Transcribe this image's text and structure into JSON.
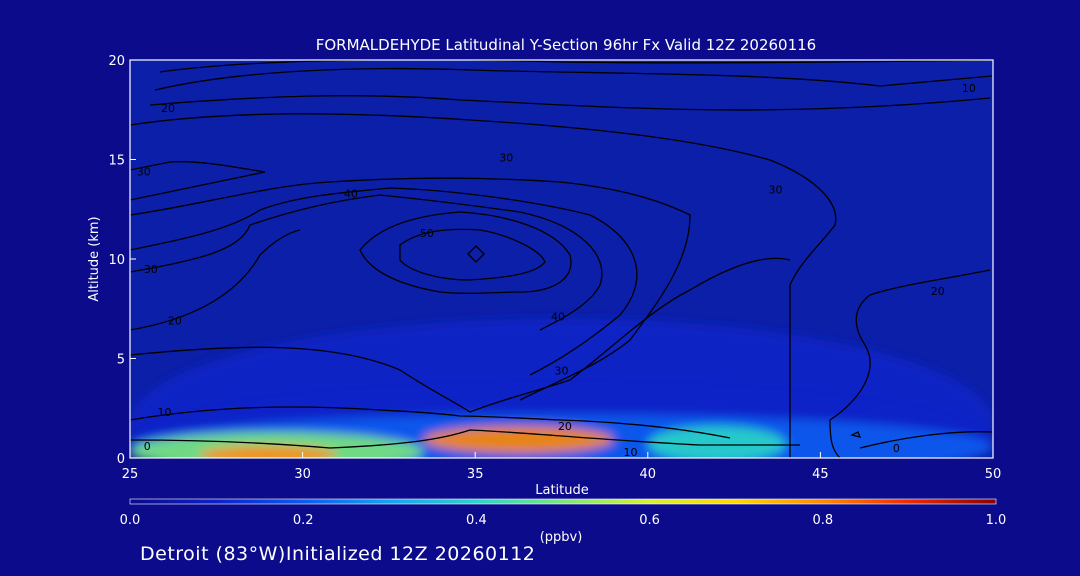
{
  "chart_data": {
    "type": "heatmap",
    "title": "FORMALDEHYDE Latitudinal Y-Section 96hr  Fx Valid 12Z 20260116",
    "xlabel": "Latitude",
    "ylabel": "Altitude (km)",
    "xlim": [
      25,
      50
    ],
    "ylim": [
      0,
      20
    ],
    "x_ticks": [
      "25",
      "30",
      "35",
      "40",
      "45",
      "50"
    ],
    "y_ticks": [
      "0",
      "5",
      "10",
      "15",
      "20"
    ],
    "colorbar": {
      "label": "(ppbv)",
      "range": [
        0.0,
        1.0
      ],
      "ticks": [
        "0.0",
        "0.2",
        "0.4",
        "0.6",
        "0.8",
        "1.0"
      ]
    },
    "colorscale": [
      "#0a0a8c",
      "#0c22c8",
      "#0a5cf0",
      "#12a6f2",
      "#2ad6c8",
      "#7be87a",
      "#d8f030",
      "#ffd800",
      "#ff8a00",
      "#ee2a00",
      "#8c0000"
    ],
    "field_regions": [
      {
        "lat": [
          25,
          50
        ],
        "alt": [
          0,
          7
        ],
        "value": 0.07
      },
      {
        "lat": [
          25,
          50
        ],
        "alt": [
          0,
          4
        ],
        "value": 0.1
      },
      {
        "lat": [
          25,
          50
        ],
        "alt": [
          0,
          2.2
        ],
        "value": 0.18
      },
      {
        "lat": [
          25,
          33.5
        ],
        "alt": [
          0,
          1.3
        ],
        "value": 0.45
      },
      {
        "lat": [
          27,
          31
        ],
        "alt": [
          0,
          0.6
        ],
        "value": 0.75
      },
      {
        "lat": [
          33.5,
          39
        ],
        "alt": [
          0.7,
          1.6
        ],
        "value": 0.8
      },
      {
        "lat": [
          40,
          44
        ],
        "alt": [
          0.4,
          1.6
        ],
        "value": 0.35
      }
    ],
    "contour_labels": [
      "0",
      "10",
      "20",
      "30",
      "40",
      "50"
    ],
    "annotations": [
      {
        "text": "0",
        "lat": 25.5,
        "alt": 0.6
      },
      {
        "text": "10",
        "lat": 26,
        "alt": 2.3
      },
      {
        "text": "20",
        "lat": 26.3,
        "alt": 6.9
      },
      {
        "text": "30",
        "lat": 25.6,
        "alt": 9.5
      },
      {
        "text": "30",
        "lat": 25.4,
        "alt": 14.4
      },
      {
        "text": "20",
        "lat": 26.1,
        "alt": 17.6
      },
      {
        "text": "40",
        "lat": 31.4,
        "alt": 13.3
      },
      {
        "text": "50",
        "lat": 33.6,
        "alt": 11.3
      },
      {
        "text": "30",
        "lat": 35.9,
        "alt": 15.1
      },
      {
        "text": "30",
        "lat": 43.7,
        "alt": 13.5
      },
      {
        "text": "40",
        "lat": 37.4,
        "alt": 7.1
      },
      {
        "text": "30",
        "lat": 37.5,
        "alt": 4.4
      },
      {
        "text": "20",
        "lat": 37.6,
        "alt": 1.6
      },
      {
        "text": "10",
        "lat": 39.5,
        "alt": 0.3
      },
      {
        "text": "20",
        "lat": 48.4,
        "alt": 8.4
      },
      {
        "text": "10",
        "lat": 49.3,
        "alt": 18.6
      },
      {
        "text": "0",
        "lat": 47.2,
        "alt": 0.5
      }
    ]
  },
  "footer": "Detroit (83°W)Initialized 12Z 20260112"
}
